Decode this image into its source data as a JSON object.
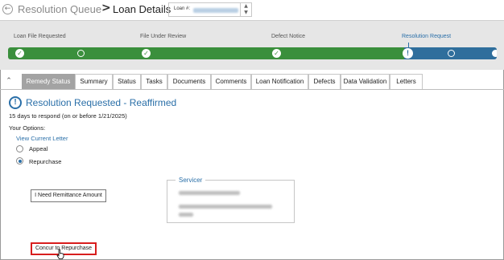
{
  "header": {
    "back_icon": "back-arrow-icon",
    "breadcrumb_parent": "Resolution Queue",
    "breadcrumb_separator": ">",
    "breadcrumb_current": "Loan Details",
    "loan_label": "Loan #:"
  },
  "progress": {
    "stages": [
      "Loan File Requested",
      "File Under Review",
      "Defect Notice",
      "Resolution Request"
    ],
    "current_stage": "Resolution Request",
    "colors": {
      "completed": "#3a8f3c",
      "remaining": "#2f6e9c"
    }
  },
  "tabs": [
    {
      "label": "Remedy Status",
      "active": true
    },
    {
      "label": "Summary"
    },
    {
      "label": "Status"
    },
    {
      "label": "Tasks"
    },
    {
      "label": "Documents"
    },
    {
      "label": "Comments"
    },
    {
      "label": "Loan Notification"
    },
    {
      "label": "Defects"
    },
    {
      "label": "Data Validation"
    },
    {
      "label": "Letters"
    }
  ],
  "content": {
    "status_title": "Resolution Requested - Reaffirmed",
    "respond_text": "15 days to respond (on or before 1/21/2025)",
    "options_label": "Your Options:",
    "view_letter": "View Current Letter",
    "options": [
      {
        "label": "Appeal",
        "selected": false
      },
      {
        "label": "Repurchase",
        "selected": true
      }
    ],
    "remittance_button": "I Need Remittance Amount",
    "servicer_title": "Servicer",
    "concur_button": "Concur to Repurchase"
  },
  "accent_color": "#2a6fa8",
  "highlight_color": "#d81e1e"
}
